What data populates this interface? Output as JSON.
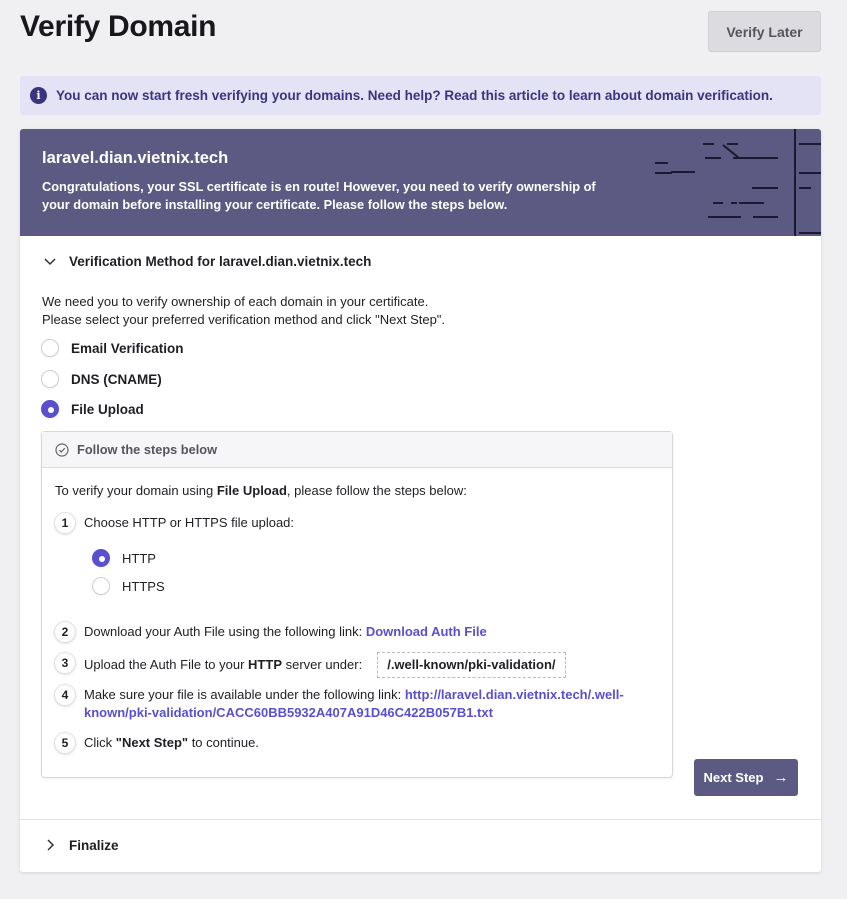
{
  "page": {
    "title": "Verify Domain",
    "verify_later_label": "Verify Later"
  },
  "banner": {
    "icon": "info-icon",
    "text": "You can now start fresh verifying your domains. Need help? Read this article to learn about domain verification."
  },
  "header": {
    "domain": "laravel.dian.vietnix.tech",
    "message": "Congratulations, your SSL certificate is en route! However, you need to verify ownership of your domain before installing your certificate. Please follow the steps below."
  },
  "verification": {
    "section_title": "Verification Method for laravel.dian.vietnix.tech",
    "intro_line1": "We need you to verify ownership of each domain in your certificate.",
    "intro_line2": "Please select your preferred verification method and click \"Next Step\".",
    "methods": [
      {
        "label": "Email Verification",
        "checked": false
      },
      {
        "label": "DNS (CNAME)",
        "checked": false
      },
      {
        "label": "File Upload",
        "checked": true
      }
    ],
    "steps_header": "Follow the steps below",
    "steps_intro_pre": "To verify your domain using ",
    "steps_intro_bold": "File Upload",
    "steps_intro_post": ", please follow the steps below:",
    "steps": {
      "s1": {
        "num": "1",
        "text": "Choose HTTP or HTTPS file upload:"
      },
      "s2": {
        "num": "2",
        "text": "Download your Auth File using the following link: ",
        "link": "Download Auth File"
      },
      "s3": {
        "num": "3",
        "text_pre": "Upload the Auth File to your ",
        "text_bold": "HTTP",
        "text_post": " server under:",
        "path": "/.well-known/pki-validation/"
      },
      "s4": {
        "num": "4",
        "text": "Make sure your file is available under the following link: ",
        "link_line1": "http://laravel.dian.vietnix.tech/.well-",
        "link_line2": "known/pki-validation/CACC60BB5932A407A91D46C422B057B1.txt"
      },
      "s5": {
        "num": "5",
        "text_pre": "Click ",
        "text_bold": "\"Next Step\"",
        "text_post": " to continue."
      }
    },
    "protocols": [
      {
        "label": "HTTP",
        "checked": true
      },
      {
        "label": "HTTPS",
        "checked": false
      }
    ],
    "next_step_label": "Next Step"
  },
  "finalize": {
    "section_title": "Finalize"
  }
}
